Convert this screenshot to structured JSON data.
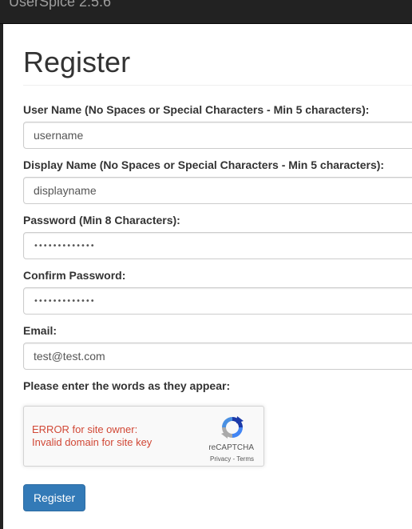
{
  "navbar": {
    "brand": "UserSpice 2.5.6"
  },
  "page": {
    "title": "Register"
  },
  "form": {
    "username": {
      "label": "User Name (No Spaces or Special Characters - Min 5 characters):",
      "value": "username"
    },
    "display_name": {
      "label": "Display Name (No Spaces or Special Characters - Min 5 characters):",
      "value": "displayname"
    },
    "password": {
      "label": "Password (Min 8 Characters):",
      "value": "•••••••••••••"
    },
    "confirm_password": {
      "label": "Confirm Password:",
      "value": "•••••••••••••"
    },
    "email": {
      "label": "Email:",
      "value": "test@test.com"
    },
    "captcha_prompt": "Please enter the words as they appear:",
    "register_label": "Register"
  },
  "captcha": {
    "error_line1": "ERROR for site owner:",
    "error_line2": "Invalid domain for site key",
    "brand": "reCAPTCHA",
    "privacy": "Privacy",
    "separator": " - ",
    "terms": "Terms"
  },
  "colors": {
    "navbar_bg": "#222222",
    "brand_text": "#9d9d9d",
    "primary": "#337ab7",
    "error": "#d14836"
  }
}
